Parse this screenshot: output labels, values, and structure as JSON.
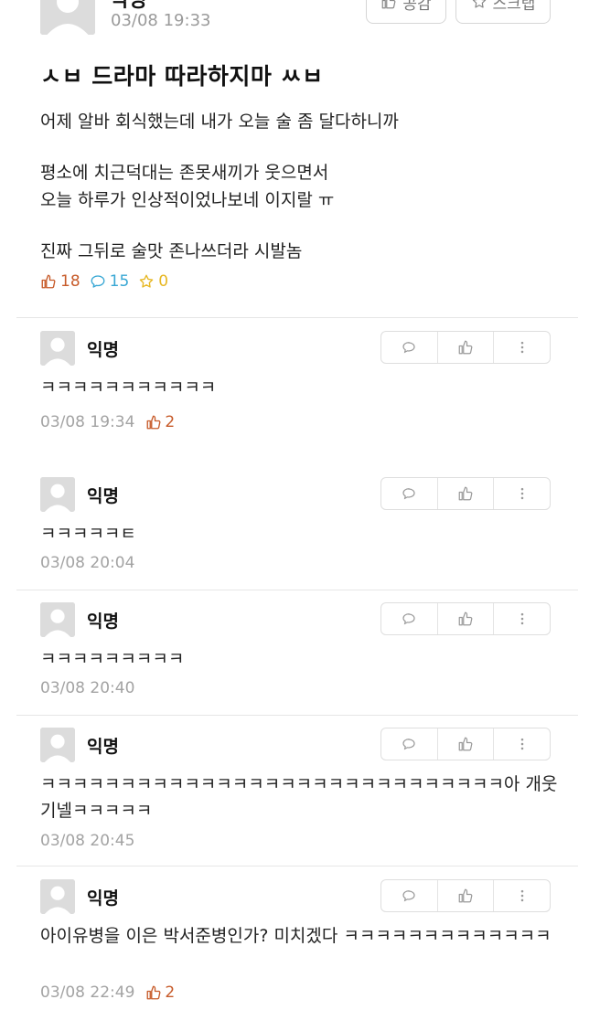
{
  "post": {
    "author": "익명",
    "time": "03/08 19:33",
    "like_button_label": "공감",
    "scrap_button_label": "스크랩",
    "title": "ㅅㅂ 드라마 따라하지마 ㅆㅂ",
    "body_lines": [
      "어제 알바 회식했는데 내가 오늘 술 좀 달다하니까",
      "평소에 치근덕대는 존못새끼가 웃으면서",
      "오늘 하루가 인상적이었나보네 이지랄 ㅠ",
      "진짜 그뒤로 술맛 존나쓰더라 시발놈"
    ],
    "stats": {
      "likes": "18",
      "comments": "15",
      "scraps": "0"
    }
  },
  "comments": [
    {
      "author": "익명",
      "text": "ㅋㅋㅋㅋㅋㅋㅋㅋㅋㅋㅋ",
      "time": "03/08 19:34",
      "likes": "2"
    },
    {
      "author": "익명",
      "text": "ㅋㅋㅋㅋㅋㅌ",
      "time": "03/08 20:04",
      "likes": ""
    },
    {
      "author": "익명",
      "text": "ㅋㅋㅋㅋㅋㅋㅋㅋㅋ",
      "time": "03/08 20:40",
      "likes": ""
    },
    {
      "author": "익명",
      "text": "ㅋㅋㅋㅋㅋㅋㅋㅋㅋㅋㅋㅋㅋㅋㅋㅋㅋㅋㅋㅋㅋㅋㅋㅋㅋㅋㅋㅋㅋ아 개웃기넬ㅋㅋㅋㅋㅋ",
      "time": "03/08 20:45",
      "likes": ""
    },
    {
      "author": "익명",
      "text": "아이유병을 이은 박서준병인가? 미치겠다 ㅋㅋㅋㅋㅋㅋㅋㅋㅋㅋㅋㅋㅋ",
      "time": "03/08 22:49",
      "likes": "2"
    }
  ],
  "icons": {
    "like": "thumbs-up-icon",
    "comment": "speech-bubble-icon",
    "scrap": "star-icon",
    "more": "vertical-dots-icon",
    "avatar": "default-avatar-icon"
  },
  "colors": {
    "like": "#c75b2a",
    "comment": "#38a7d4",
    "scrap": "#e7b722",
    "meta": "#a3a3a3",
    "divider": "#e6e6e6"
  }
}
